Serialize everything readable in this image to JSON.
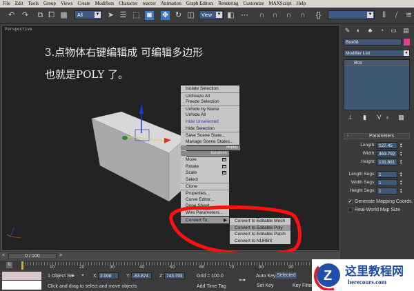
{
  "menu": [
    "File",
    "Edit",
    "Tools",
    "Group",
    "Views",
    "Create",
    "Modifiers",
    "Character",
    "reactor",
    "Animation",
    "Graph Editors",
    "Rendering",
    "Customize",
    "MAXScript",
    "Help"
  ],
  "toolbar": {
    "selection_filter": "All",
    "ref_coord": "View",
    "colors": {
      "active": "#3d7cc0",
      "field": "#3e5a82"
    }
  },
  "viewport": {
    "label": "Perspective",
    "caption_line1": "3.点物体右键编辑成 可编辑多边形",
    "caption_line2": "也就是POLY 了。"
  },
  "context_menu": {
    "display_items": [
      "Isolate Selection",
      "Unfreeze All",
      "Freeze Selection",
      "Unhide by Name",
      "Unhide All",
      "Hide Unselected",
      "Hide Selection",
      "Save Scene State...",
      "Manage Scene States..."
    ],
    "display_header": "display",
    "transform_header": "transform",
    "transform_items": [
      "Move",
      "Rotate",
      "Scale",
      "Select",
      "Clone",
      "Properties...",
      "Curve Editor...",
      "Dope Sheet...",
      "Wire Parameters...",
      "Convert To:"
    ],
    "submenu": [
      "Convert to Editable Mesh",
      "Convert to Editable Poly",
      "Convert to Editable Patch",
      "Convert to NURBS"
    ],
    "highlighted_submenu_item": "Convert to Editable Poly",
    "hover_color": "#3333cc",
    "annotation_color": "#ff1010"
  },
  "command_panel": {
    "object_name": "Box08",
    "object_color": "#e0408a",
    "modifier_list": "Modifier List",
    "stack_item": "Box",
    "rollout": "Parameters",
    "rollout_toggle": "-",
    "params": [
      {
        "label": "Length:",
        "value": "127.45"
      },
      {
        "label": "Width:",
        "value": "463.792"
      },
      {
        "label": "Height:",
        "value": "131.881"
      }
    ],
    "segs": [
      {
        "label": "Length Segs:",
        "value": "1"
      },
      {
        "label": "Width Segs:",
        "value": "1"
      },
      {
        "label": "Height Segs:",
        "value": "1"
      }
    ],
    "checkboxes": [
      {
        "label": "Generate Mapping Coords.",
        "checked": true
      },
      {
        "label": "Real-World Map Size",
        "checked": false
      }
    ]
  },
  "timeline": {
    "frame": "0 / 100",
    "ticks": [
      "10",
      "20",
      "30",
      "40",
      "50",
      "60",
      "70",
      "80",
      "90"
    ]
  },
  "status": {
    "selection": "1 Object Se",
    "x_label": "X:",
    "x": "3.008",
    "y_label": "Y:",
    "y": "-63.874",
    "z_label": "Z:",
    "z": "743.793",
    "grid": "Grid = 100.0",
    "prompt": "Click and drag to select and move objects",
    "add_time_tag": "Add Time Tag",
    "auto_key": "Auto Key",
    "selected": "Selected",
    "set_key": "Set Key",
    "key_filters": "Key Filters..."
  },
  "watermark": {
    "logo_text": "这里教程网",
    "url": "herecours.com"
  }
}
